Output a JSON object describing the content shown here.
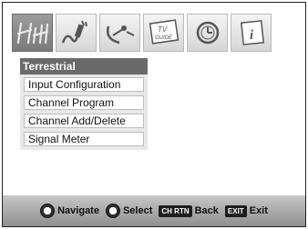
{
  "tabs": [
    {
      "icon": "antenna-icon"
    },
    {
      "icon": "plug-cable-icon"
    },
    {
      "icon": "satellite-dish-icon"
    },
    {
      "icon": "tv-guide-icon",
      "text_top": "TV",
      "text_bottom": "GUIDE"
    },
    {
      "icon": "clock-icon"
    },
    {
      "icon": "info-icon"
    }
  ],
  "menu": {
    "title": "Terrestrial",
    "items": [
      {
        "label": "Input Configuration"
      },
      {
        "label": "Channel Program"
      },
      {
        "label": "Channel Add/Delete"
      },
      {
        "label": "Signal Meter"
      }
    ]
  },
  "footer": {
    "navigate_label": "Navigate",
    "select_label": "Select",
    "back_key": "CH RTN",
    "back_label": "Back",
    "exit_key": "EXIT",
    "exit_label": "Exit"
  }
}
